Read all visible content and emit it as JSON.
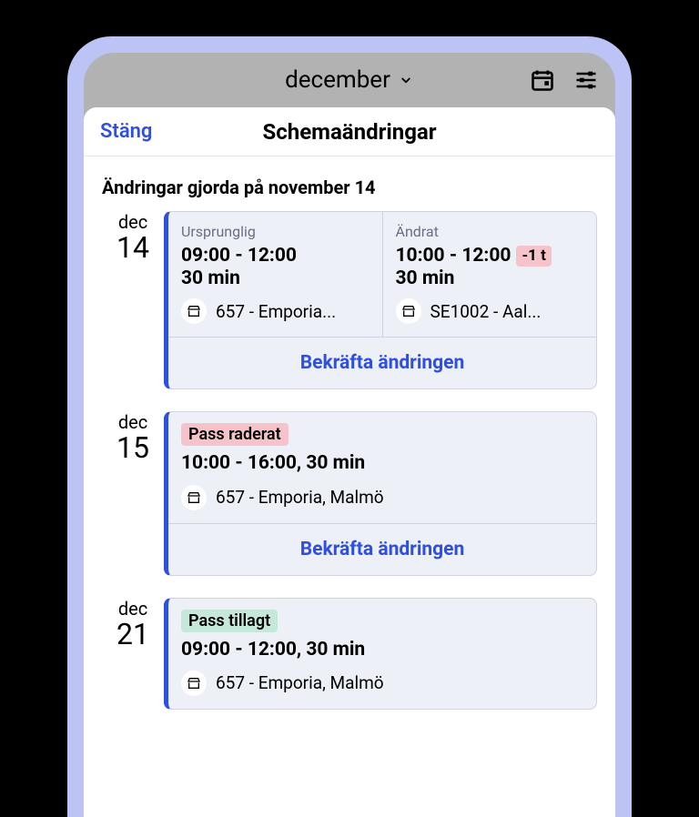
{
  "topbar": {
    "month_label": "december"
  },
  "sheet": {
    "close_label": "Stäng",
    "title": "Schemaändringar",
    "section_heading": "Ändringar gjorda på november 14",
    "confirm_label": "Bekräfta ändringen"
  },
  "labels": {
    "original": "Ursprunglig",
    "changed": "Ändrat"
  },
  "entries": [
    {
      "month": "dec",
      "day": "14",
      "type": "modified",
      "original": {
        "time": "09:00 - 12:00",
        "break": "30 min",
        "location": "657 - Emporia..."
      },
      "changed": {
        "time": "10:00 - 12:00",
        "delta": "-1 t",
        "break": "30 min",
        "location": "SE1002 - Aal..."
      }
    },
    {
      "month": "dec",
      "day": "15",
      "type": "deleted",
      "status_text": "Pass raderat",
      "time": "10:00 - 16:00, 30 min",
      "location": "657 - Emporia, Malmö"
    },
    {
      "month": "dec",
      "day": "21",
      "type": "added",
      "status_text": "Pass tillagt",
      "time": "09:00 - 12:00, 30 min",
      "location": "657 - Emporia, Malmö"
    }
  ]
}
